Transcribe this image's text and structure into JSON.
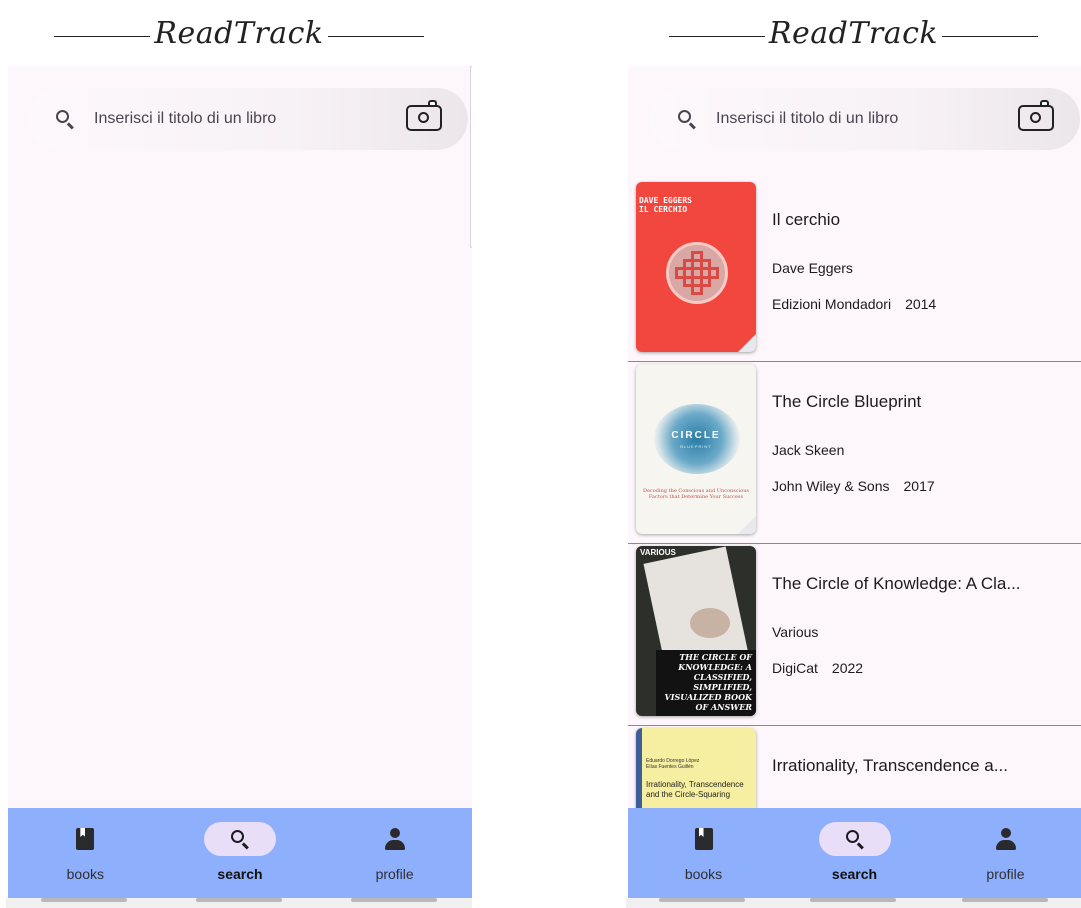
{
  "app": {
    "brand": "ReadTrack"
  },
  "search": {
    "placeholder": "Inserisci il titolo di un libro"
  },
  "nav": [
    {
      "label": "books",
      "icon": "book-icon"
    },
    {
      "label": "search",
      "icon": "search-icon",
      "active": true
    },
    {
      "label": "profile",
      "icon": "person-icon"
    }
  ],
  "results": [
    {
      "title": "Il cerchio",
      "author": "Dave Eggers",
      "publisher": "Edizioni Mondadori",
      "year": "2014",
      "cover_text": [
        "DAVE EGGERS",
        "IL CERCHIO"
      ]
    },
    {
      "title": "The Circle Blueprint",
      "author": "Jack Skeen",
      "publisher": "John Wiley & Sons",
      "year": "2017",
      "cover_text": [
        "CIRCLE",
        "BLUEPRINT",
        "Decoding the Conscious and Unconscious Factors that Determine Your Success"
      ]
    },
    {
      "title": "The Circle of Knowledge: A Cla...",
      "author": "Various",
      "publisher": "DigiCat",
      "year": "2022",
      "cover_text": [
        "VARIOUS",
        "THE CIRCLE OF KNOWLEDGE: A CLASSIFIED, SIMPLIFIED, VISUALIZED BOOK OF ANSWER"
      ]
    },
    {
      "title": "Irrationality, Transcendence a...",
      "cover_text": [
        "Eduardo Dorrego López",
        "Elías Fuentes Guillén",
        "Irrationality, Transcendence and the Circle-Squaring"
      ]
    }
  ],
  "colors": {
    "navbar": "#8eaffb",
    "active_pill": "#e8def8",
    "background": "#fdf7fc",
    "cover_red": "#f2473f"
  }
}
